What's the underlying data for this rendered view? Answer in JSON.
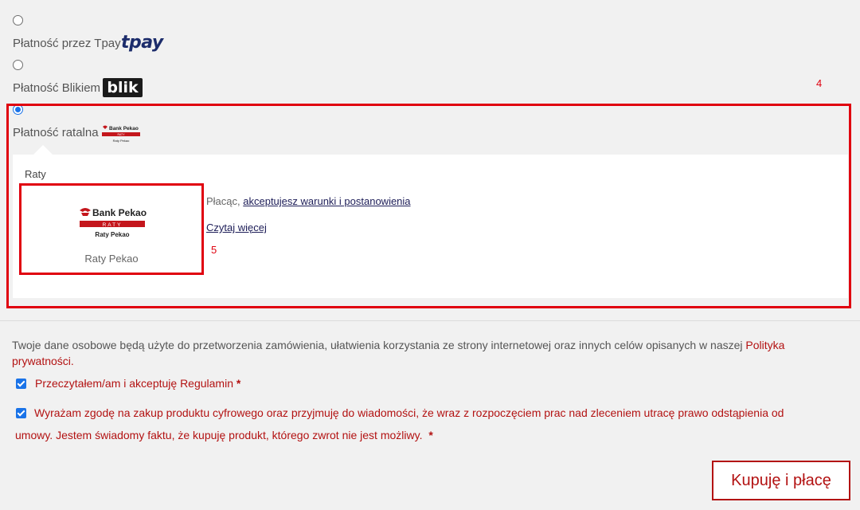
{
  "payment_options": {
    "tpay": {
      "label": "Płatność przez Tpay",
      "logo_text": "tpay"
    },
    "blik": {
      "label": "Płatność Blikiem",
      "logo_text": "blik"
    },
    "raty": {
      "label": "Płatność ratalna"
    }
  },
  "annotations": {
    "box_4": "4",
    "box_5": "5"
  },
  "installments": {
    "section_title": "Raty",
    "provider_card": {
      "logo_bank": "Bank Pekao",
      "logo_band": "RATY",
      "logo_sub": "Raty Pekao",
      "caption": "Raty Pekao"
    },
    "terms_prefix": "Płacąc, ",
    "terms_link": "akceptujesz warunki i postanowienia",
    "read_more": "Czytaj więcej"
  },
  "privacy": {
    "text": "Twoje dane osobowe będą użyte do przetworzenia zamówienia, ułatwienia korzystania ze strony internetowej oraz innych celów opisanych w naszej ",
    "link": "Polityka",
    "link_cont": "prywatności."
  },
  "consents": {
    "regulamin": {
      "text": "Przeczytałem/am i akceptuję Regulamin",
      "required": "*"
    },
    "digital_line1": "Wyrażam zgodę na zakup produktu cyfrowego oraz przyjmuję do wiadomości, że wraz z rozpoczęciem prac nad zleceniem utracę prawo odstąpienia od",
    "digital_line2": "umowy. Jestem świadomy faktu, że kupuję produkt, którego zwrot nie jest możliwy.",
    "digital_required": "*"
  },
  "submit": {
    "label": "Kupuję i płacę"
  },
  "colors": {
    "accent_red": "#b31212",
    "highlight_red": "#e0000f",
    "radio_blue": "#1a73e8"
  }
}
